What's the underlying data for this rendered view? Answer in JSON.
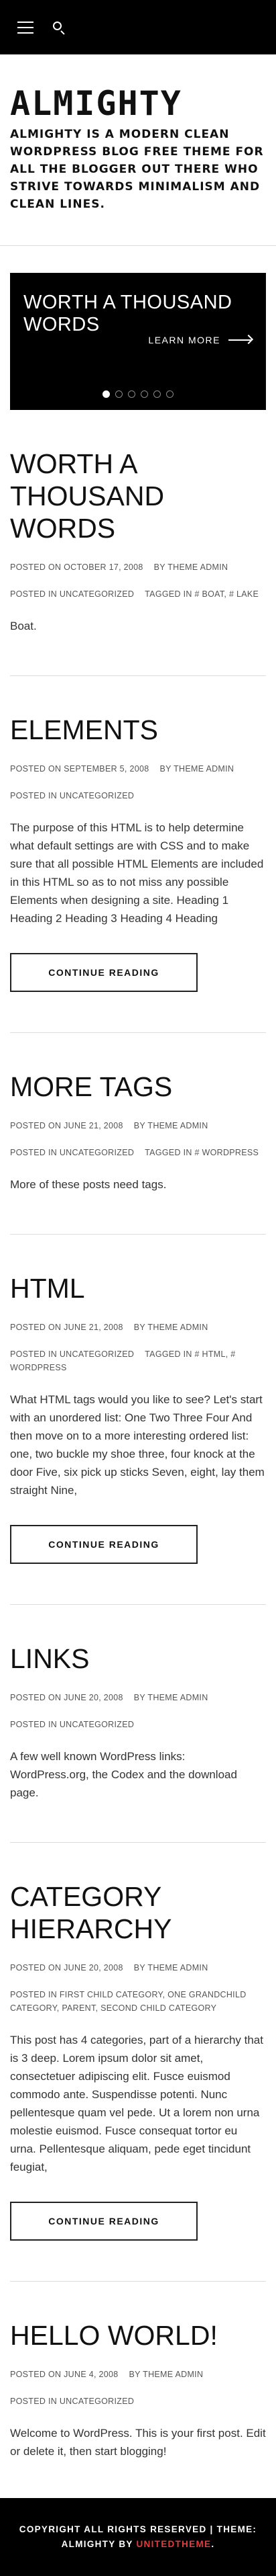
{
  "header": {
    "site_title": "ALMIGHTY",
    "site_description": "Almighty is a modern clean WordPress blog free theme for all the blogger out there who strive towards minimalism and clean lines."
  },
  "slider": {
    "title": "WORTH A THOUSAND WORDS",
    "learn_more": "LEARN MORE",
    "slides_count": 6,
    "active_slide": 1
  },
  "labels": {
    "posted_on": "POSTED ON",
    "by": "BY",
    "posted_in": "POSTED IN",
    "tagged_in": "TAGGED IN",
    "continue_reading": "CONTINUE READING"
  },
  "posts": [
    {
      "title": "WORTH A THOUSAND WORDS",
      "date": "OCTOBER 17, 2008",
      "author": "THEME ADMIN",
      "categories": "UNCATEGORIZED",
      "tags": "# BOAT, # LAKE",
      "excerpt": "Boat.",
      "has_continue": false
    },
    {
      "title": "ELEMENTS",
      "date": "SEPTEMBER 5, 2008",
      "author": "THEME ADMIN",
      "categories": "UNCATEGORIZED",
      "tags": "",
      "excerpt": "The purpose of this HTML is to help determine what default settings are with CSS and to make sure that all possible HTML Elements are included in this HTML so as to not miss any possible Elements when designing a site. Heading 1 Heading 2 Heading 3 Heading 4 Heading",
      "has_continue": true
    },
    {
      "title": "MORE TAGS",
      "date": "JUNE 21, 2008",
      "author": "THEME ADMIN",
      "categories": "UNCATEGORIZED",
      "tags": "# WORDPRESS",
      "excerpt": "More of these posts need tags.",
      "has_continue": false
    },
    {
      "title": "HTML",
      "date": "JUNE 21, 2008",
      "author": "THEME ADMIN",
      "categories": "UNCATEGORIZED",
      "tags": "# HTML, # WORDPRESS",
      "excerpt": "What HTML tags would you like to see? Let's start with an unordered list: One Two Three Four And then move on to a more interesting ordered list: one, two buckle my shoe three, four knock at the door Five, six pick up sticks Seven, eight, lay them straight Nine,",
      "has_continue": true
    },
    {
      "title": "LINKS",
      "date": "JUNE 20, 2008",
      "author": "THEME ADMIN",
      "categories": "UNCATEGORIZED",
      "tags": "",
      "excerpt": "A few well known WordPress links: WordPress.org, the Codex and the download page.",
      "has_continue": false
    },
    {
      "title": "CATEGORY HIERARCHY",
      "date": "JUNE 20, 2008",
      "author": "THEME ADMIN",
      "categories": "FIRST CHILD CATEGORY, ONE GRANDCHILD CATEGORY, PARENT, SECOND CHILD CATEGORY",
      "tags": "",
      "excerpt": "This post has 4 categories, part of a hierarchy that is 3 deep. Lorem ipsum dolor sit amet, consectetuer adipiscing elit. Fusce euismod commodo ante. Suspendisse potenti. Nunc pellentesque quam vel pede. Ut a lorem non urna molestie euismod. Fusce consequat tortor eu urna. Pellentesque aliquam, pede eget tincidunt feugiat,",
      "has_continue": true
    },
    {
      "title": "HELLO WORLD!",
      "date": "JUNE 4, 2008",
      "author": "THEME ADMIN",
      "categories": "UNCATEGORIZED",
      "tags": "",
      "excerpt": "Welcome to WordPress. This is your first post. Edit or delete it, then start blogging!",
      "has_continue": false
    }
  ],
  "footer": {
    "copyright": "COPYRIGHT ALL RIGHTS RESERVED | THEME: ALMIGHTY BY ",
    "brand": "UNITEDTHEME",
    "end": "."
  },
  "colors": {
    "topbar": "#000000",
    "accent": "#e23b3b"
  }
}
